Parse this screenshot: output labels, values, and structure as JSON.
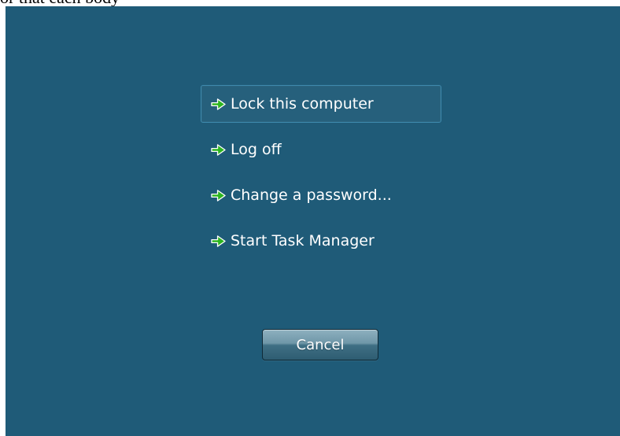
{
  "top_text": "or that each body",
  "menu": {
    "items": [
      {
        "label": "Lock this computer",
        "icon": "green-right-arrow-icon",
        "selected": true
      },
      {
        "label": "Log off",
        "icon": "green-right-arrow-icon",
        "selected": false
      },
      {
        "label": "Change a password...",
        "icon": "green-right-arrow-icon",
        "selected": false
      },
      {
        "label": "Start Task Manager",
        "icon": "green-right-arrow-icon",
        "selected": false
      }
    ]
  },
  "cancel_label": "Cancel",
  "colors": {
    "background": "#1f5b78",
    "accent_border": "#3e8aad",
    "arrow_green": "#2db51f",
    "text": "#ffffff"
  }
}
